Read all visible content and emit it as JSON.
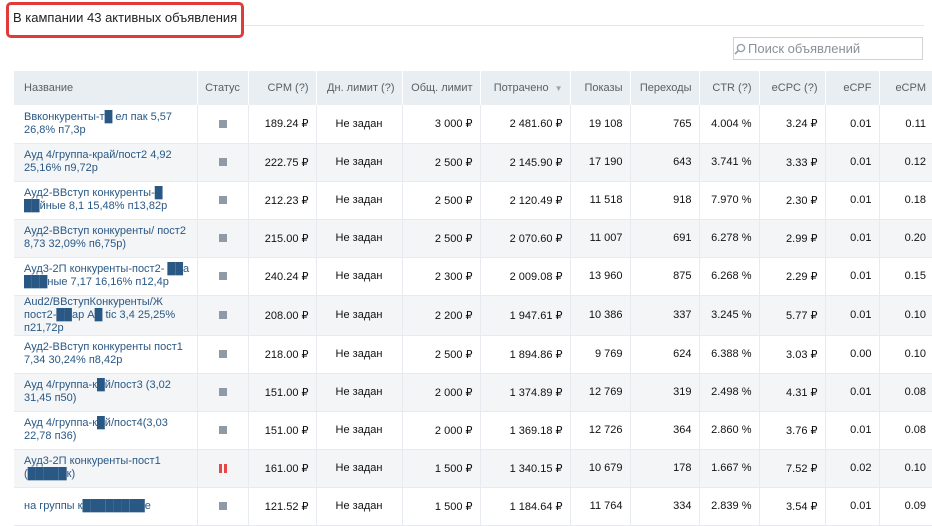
{
  "summary": {
    "text": "В кампании 43 активных объявления"
  },
  "search": {
    "placeholder": "Поиск объявлений",
    "icon": "search-icon"
  },
  "colors": {
    "highlight_border": "#e03a3a",
    "link": "#2a5885",
    "header_bg": "#e9eef3",
    "status_active": "#8f9aa6",
    "status_paused": "#e64646"
  },
  "table": {
    "columns": [
      "Название",
      "Статус",
      "CPM (?)",
      "Дн. лимит (?)",
      "Общ. лимит",
      "Потрачено",
      "Показы",
      "Переходы",
      "CTR (?)",
      "eCPC (?)",
      "eCPF",
      "eCPM"
    ],
    "sorted_column": "Потрачено",
    "rows": [
      {
        "name": "Ввконкуренты-т█ ел пак 5,57 26,8% п7,3р",
        "status": "active",
        "cpm": "189.24 ₽",
        "daily_limit": "Не задан",
        "total_limit": "3 000 ₽",
        "spent": "2 481.60 ₽",
        "impressions": "19 108",
        "clicks": "765",
        "ctr": "4.004 %",
        "ecpc": "3.24 ₽",
        "ecpf": "0.01",
        "ecpm": "0.11"
      },
      {
        "name": "Ауд 4/группа-край/пост2 4,92 25,16% п9,72р",
        "status": "active",
        "cpm": "222.75 ₽",
        "daily_limit": "Не задан",
        "total_limit": "2 500 ₽",
        "spent": "2 145.90 ₽",
        "impressions": "17 190",
        "clicks": "643",
        "ctr": "3.741 %",
        "ecpc": "3.33 ₽",
        "ecpf": "0.01",
        "ecpm": "0.12"
      },
      {
        "name": "Ауд2-ВВступ конкуренты-█ ██йные 8,1 15,48% п13,82р",
        "status": "active",
        "cpm": "212.23 ₽",
        "daily_limit": "Не задан",
        "total_limit": "2 500 ₽",
        "spent": "2 120.49 ₽",
        "impressions": "11 518",
        "clicks": "918",
        "ctr": "7.970 %",
        "ecpc": "2.30 ₽",
        "ecpf": "0.01",
        "ecpm": "0.18"
      },
      {
        "name": "Ауд2-ВВступ конкуренты/ пост2 8,73 32,09% п6,75р)",
        "status": "active",
        "cpm": "215.00 ₽",
        "daily_limit": "Не задан",
        "total_limit": "2 500 ₽",
        "spent": "2 070.60 ₽",
        "impressions": "11 007",
        "clicks": "691",
        "ctr": "6.278 %",
        "ecpc": "2.99 ₽",
        "ecpf": "0.01",
        "ecpm": "0.20"
      },
      {
        "name": "Ауд3-2П конкуренты-пост2- ██а ███ные 7,17 16,16% п12,4р",
        "status": "active",
        "cpm": "240.24 ₽",
        "daily_limit": "Не задан",
        "total_limit": "2 300 ₽",
        "spent": "2 009.08 ₽",
        "impressions": "13 960",
        "clicks": "875",
        "ctr": "6.268 %",
        "ecpc": "2.29 ₽",
        "ecpf": "0.01",
        "ecpm": "0.15"
      },
      {
        "name": "Aud2/ВВступКонкуренты/Ж пост2-██ар А█ tic 3,4 25,25% п21,72р",
        "status": "active",
        "cpm": "208.00 ₽",
        "daily_limit": "Не задан",
        "total_limit": "2 200 ₽",
        "spent": "1 947.61 ₽",
        "impressions": "10 386",
        "clicks": "337",
        "ctr": "3.245 %",
        "ecpc": "5.77 ₽",
        "ecpf": "0.01",
        "ecpm": "0.10"
      },
      {
        "name": "Ауд2-ВВступ конкуренты пост1 7,34 30,24% п8,42р",
        "status": "active",
        "cpm": "218.00 ₽",
        "daily_limit": "Не задан",
        "total_limit": "2 500 ₽",
        "spent": "1 894.86 ₽",
        "impressions": "9 769",
        "clicks": "624",
        "ctr": "6.388 %",
        "ecpc": "3.03 ₽",
        "ecpf": "0.00",
        "ecpm": "0.10"
      },
      {
        "name": "Ауд 4/группа-к█й/пост3 (3,02 31,45 п50)",
        "status": "active",
        "cpm": "151.00 ₽",
        "daily_limit": "Не задан",
        "total_limit": "2 000 ₽",
        "spent": "1 374.89 ₽",
        "impressions": "12 769",
        "clicks": "319",
        "ctr": "2.498 %",
        "ecpc": "4.31 ₽",
        "ecpf": "0.01",
        "ecpm": "0.08"
      },
      {
        "name": "Ауд 4/группа-к█й/пост4(3,03 22,78 п36)",
        "status": "active",
        "cpm": "151.00 ₽",
        "daily_limit": "Не задан",
        "total_limit": "2 000 ₽",
        "spent": "1 369.18 ₽",
        "impressions": "12 726",
        "clicks": "364",
        "ctr": "2.860 %",
        "ecpc": "3.76 ₽",
        "ecpf": "0.01",
        "ecpm": "0.08"
      },
      {
        "name": "Ауд3-2П конкуренты-пост1 (█████к)",
        "status": "paused",
        "cpm": "161.00 ₽",
        "daily_limit": "Не задан",
        "total_limit": "1 500 ₽",
        "spent": "1 340.15 ₽",
        "impressions": "10 679",
        "clicks": "178",
        "ctr": "1.667 %",
        "ecpc": "7.52 ₽",
        "ecpf": "0.02",
        "ecpm": "0.10"
      },
      {
        "name": "на группы к████████е",
        "status": "active",
        "cpm": "121.52 ₽",
        "daily_limit": "Не задан",
        "total_limit": "1 500 ₽",
        "spent": "1 184.64 ₽",
        "impressions": "11 764",
        "clicks": "334",
        "ctr": "2.839 %",
        "ecpc": "3.54 ₽",
        "ecpf": "0.01",
        "ecpm": "0.09"
      }
    ]
  }
}
